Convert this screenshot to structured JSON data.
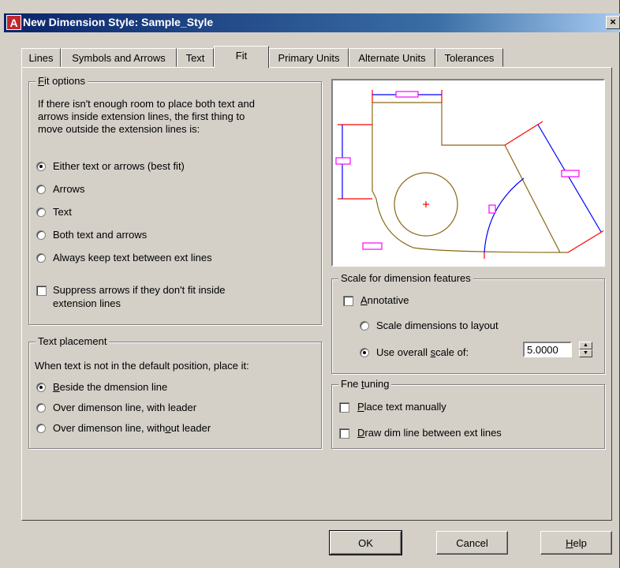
{
  "window": {
    "icon_letter": "A",
    "title": "New Dimension Style: Sample_Style",
    "close_glyph": "×"
  },
  "tabs": [
    {
      "label": "Lines"
    },
    {
      "label": "Symbols and Arrows"
    },
    {
      "label": "Text"
    },
    {
      "label": "Fit",
      "active": true
    },
    {
      "label": "Primary Units"
    },
    {
      "label": "Alternate Units"
    },
    {
      "label": "Tolerances"
    }
  ],
  "fit_options": {
    "title_prefix": "F",
    "title_rest": "it options",
    "description": [
      "If there isn't enough room to place both text and",
      "arrows inside extension lines, the first thing to",
      "move outside the extension lines is:"
    ],
    "options": [
      {
        "label": "Either text or arrows (best fit)",
        "selected": true
      },
      {
        "label": "Arrows",
        "selected": false
      },
      {
        "label": "Text",
        "selected": false
      },
      {
        "label": "Both text and arrows",
        "selected": false
      },
      {
        "label": "Always keep text between ext lines",
        "selected": false
      }
    ],
    "suppress_label": [
      "Suppress arrows if they don't fit inside",
      "extension lines"
    ],
    "suppress_checked": false
  },
  "text_placement": {
    "title": "Text placement",
    "description": "When text is not in the default position, place it:",
    "options": [
      {
        "pre": "",
        "u": "B",
        "post": "eside the dmension line",
        "selected": true
      },
      {
        "pre": "Over dimenson line, with leader",
        "u": "",
        "post": "",
        "selected": false
      },
      {
        "pre": "Over dimenson line, with",
        "u": "o",
        "post": "ut leader",
        "selected": false
      }
    ]
  },
  "scale": {
    "title": "Scale for dimension features",
    "annotative_u": "A",
    "annotative_rest": "nnotative",
    "annotative_checked": false,
    "layout_label": "Scale dimensions to layout",
    "layout_selected": false,
    "overall_pre": "Use overall ",
    "overall_u": "s",
    "overall_post": "cale of:",
    "overall_selected": true,
    "overall_value": "5.0000"
  },
  "fine_tuning": {
    "title_pre": "Fne ",
    "title_u": "t",
    "title_post": "uning",
    "manual_u": "P",
    "manual_rest": "lace text manually",
    "manual_checked": false,
    "dimline_u": "D",
    "dimline_rest": "raw dim line between ext lines",
    "dimline_checked": false
  },
  "buttons": {
    "ok": "OK",
    "cancel": "Cancel",
    "help_u": "H",
    "help_rest": "elp"
  },
  "colors": {
    "title_bar": "#0a246a",
    "dialog_bg": "#d4d0c8",
    "preview_geometry": "#8b6914",
    "preview_dimension": "#0000ff",
    "preview_extension": "#ff0000",
    "preview_text_box": "#ff00ff"
  }
}
